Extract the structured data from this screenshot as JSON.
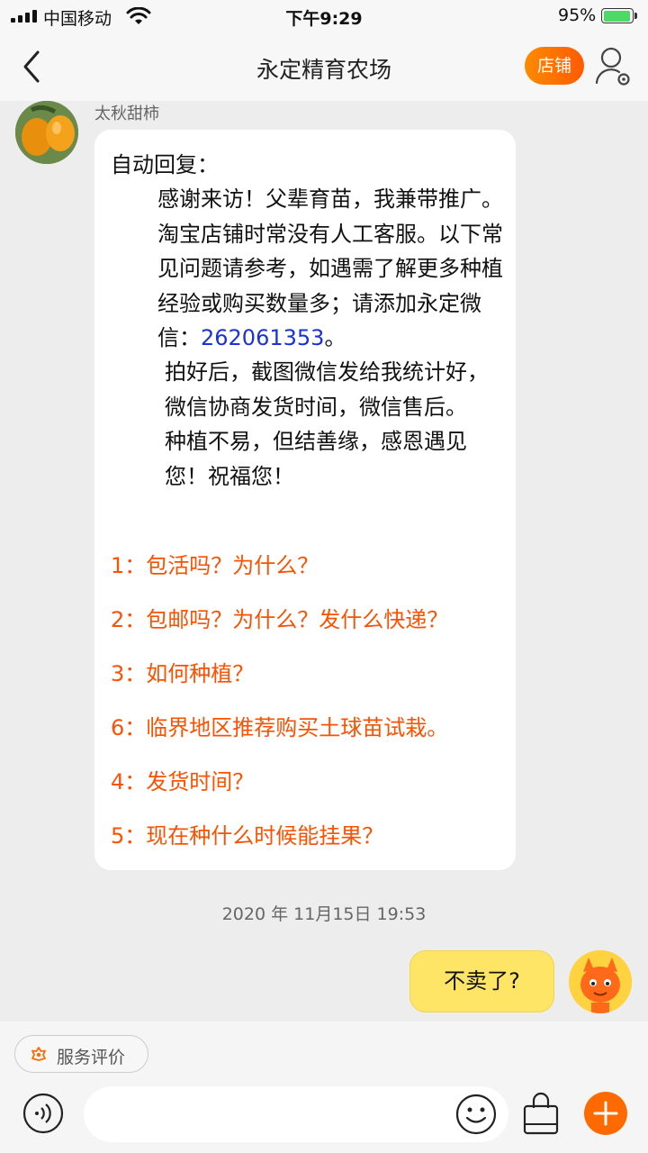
{
  "status_bar": {
    "carrier": "中国移动",
    "time": "下午9:29",
    "battery_percent": "95%"
  },
  "nav": {
    "title": "永定精育农场",
    "shop_button": "店铺"
  },
  "chat": {
    "sender_name": "太秋甜柿",
    "auto_reply": {
      "line_header": "自动回复：",
      "para1_a": "感谢来访！父辈育苗，我兼带推广。淘宝店铺时常没有人工客服。以下常见问题请参考，如遇需了解更多种植经验或购买数量多；请添加永定微信：",
      "wechat_id": "262061353",
      "para1_end": "。",
      "para2": "拍好后，截图微信发给我统计好，微信协商发货时间，微信售后。",
      "para3": "种植不易，但结善缘，感恩遇见您！祝福您！"
    },
    "faq": [
      "1：包活吗？为什么？",
      "2：包邮吗？为什么？发什么快递？",
      "3：如何种植？",
      "6：临界地区推荐购买土球苗试栽。",
      "4：发货时间？",
      "5：现在种什么时候能挂果？"
    ],
    "timestamp": "2020 年 11月15日 19:53",
    "my_message": "不卖了?"
  },
  "bottom": {
    "service_rating": "服务评价"
  },
  "colors": {
    "accent_orange": "#ff5000",
    "link_blue": "#1a33d6",
    "my_bubble": "#ffe566"
  }
}
